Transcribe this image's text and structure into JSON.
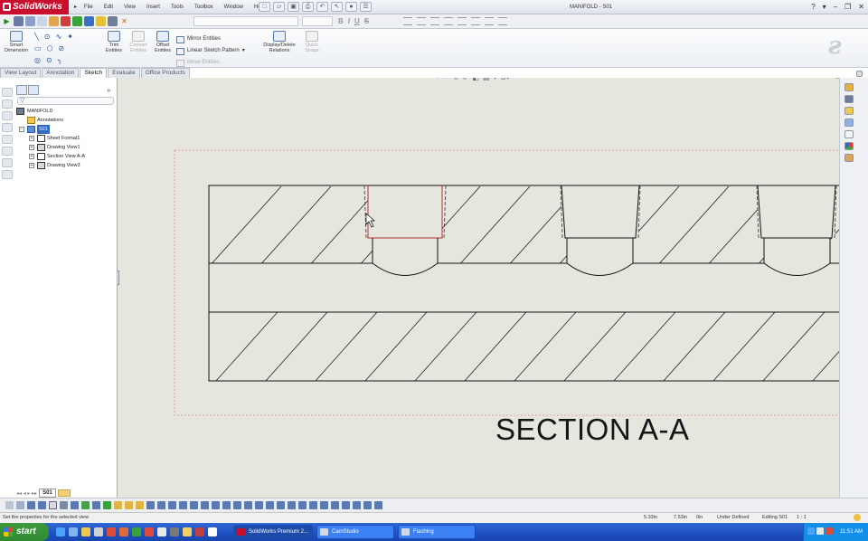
{
  "app": {
    "brand": "SolidWorks",
    "document_title": "MANIFOLD - S01"
  },
  "menu": [
    "File",
    "Edit",
    "View",
    "Insert",
    "Tools",
    "Toolbox",
    "Window",
    "Help"
  ],
  "ribbon": {
    "smart_dimension": "Smart Dimension",
    "trim_entities": "Trim Entities",
    "convert_entities": "Convert Entities",
    "offset_entities": "Offset Entities",
    "mirror_entities": "Mirror Entities",
    "linear_sketch_pattern": "Linear Sketch Pattern",
    "move_entities": "Move Entities",
    "display_delete_relations": "Display/Delete Relations",
    "quick_snaps": "Quick Snaps"
  },
  "tabs": [
    "View Layout",
    "Annotation",
    "Sketch",
    "Evaluate",
    "Office Products"
  ],
  "active_tab": "Sketch",
  "tree": {
    "root": "MANIFOLD",
    "items": [
      {
        "label": "Annotations"
      },
      {
        "label": "S01"
      },
      {
        "label": "Sheet Format1"
      },
      {
        "label": "Drawing View1"
      },
      {
        "label": "Section View A-A"
      },
      {
        "label": "Drawing View3"
      }
    ]
  },
  "sheet_tab": "S01",
  "drawing": {
    "section_label": "SECTION A-A"
  },
  "status": {
    "message": "Set the properties for the selected view",
    "x": "5.33in",
    "y": "7.53in",
    "z": "0in",
    "state": "Under Defined",
    "editing": "Editing S01",
    "scale": "1 : 1"
  },
  "taskbar": {
    "start": "start",
    "tasks": [
      "SolidWorks Premium 2...",
      "CamStudio",
      "Flashing"
    ],
    "clock": "11:51 AM"
  }
}
